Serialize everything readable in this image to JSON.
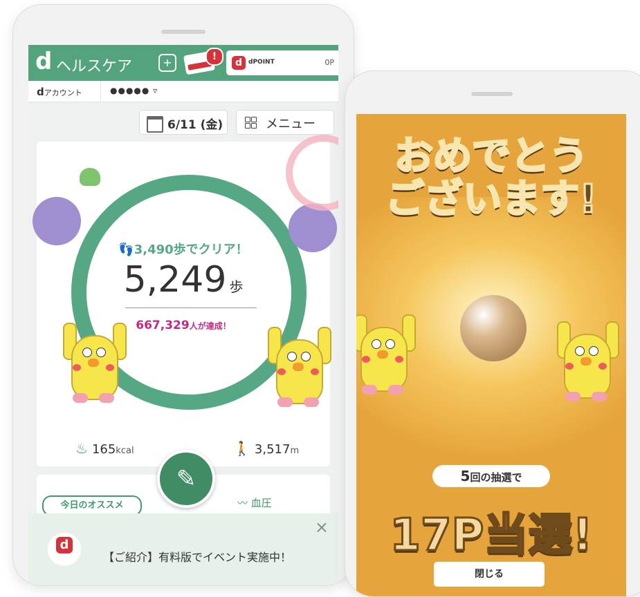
{
  "left_phone": {
    "header": {
      "logo": "d",
      "title": "ヘルスケア",
      "alert_badge": "!",
      "dpoint": {
        "logo": "d",
        "brand": "dPOINT",
        "value": "0P"
      }
    },
    "account": {
      "label_d": "d",
      "label": "アカウント",
      "masked_id": "●●●●● ▿"
    },
    "date_button": "6/11 (金)",
    "menu_button": "メニュー",
    "steps": {
      "goal": "3,490歩でクリア！",
      "count": "5,249",
      "unit": "歩",
      "achievers": "667,329",
      "achievers_suffix": "人が達成！"
    },
    "stats": {
      "kcal_value": "165",
      "kcal_unit": "kcal",
      "distance_value": "3,517",
      "distance_unit": "m"
    },
    "recommend_label": "今日のオススメ",
    "blood_pressure_label": "血圧",
    "promo": {
      "logo": "d",
      "text": "【ご紹介】有料版でイベント実施中！"
    }
  },
  "right_phone": {
    "congrats_line1": "おめでとう",
    "congrats_line2": "ございます!",
    "draws_num": "5",
    "draws_text": "回の抽選で",
    "result": "17P当選!",
    "close_button": "閉じる"
  },
  "colors": {
    "green": "#53a47c",
    "red": "#d5323a",
    "magenta": "#c22a84",
    "orange": "#e6a53c"
  }
}
